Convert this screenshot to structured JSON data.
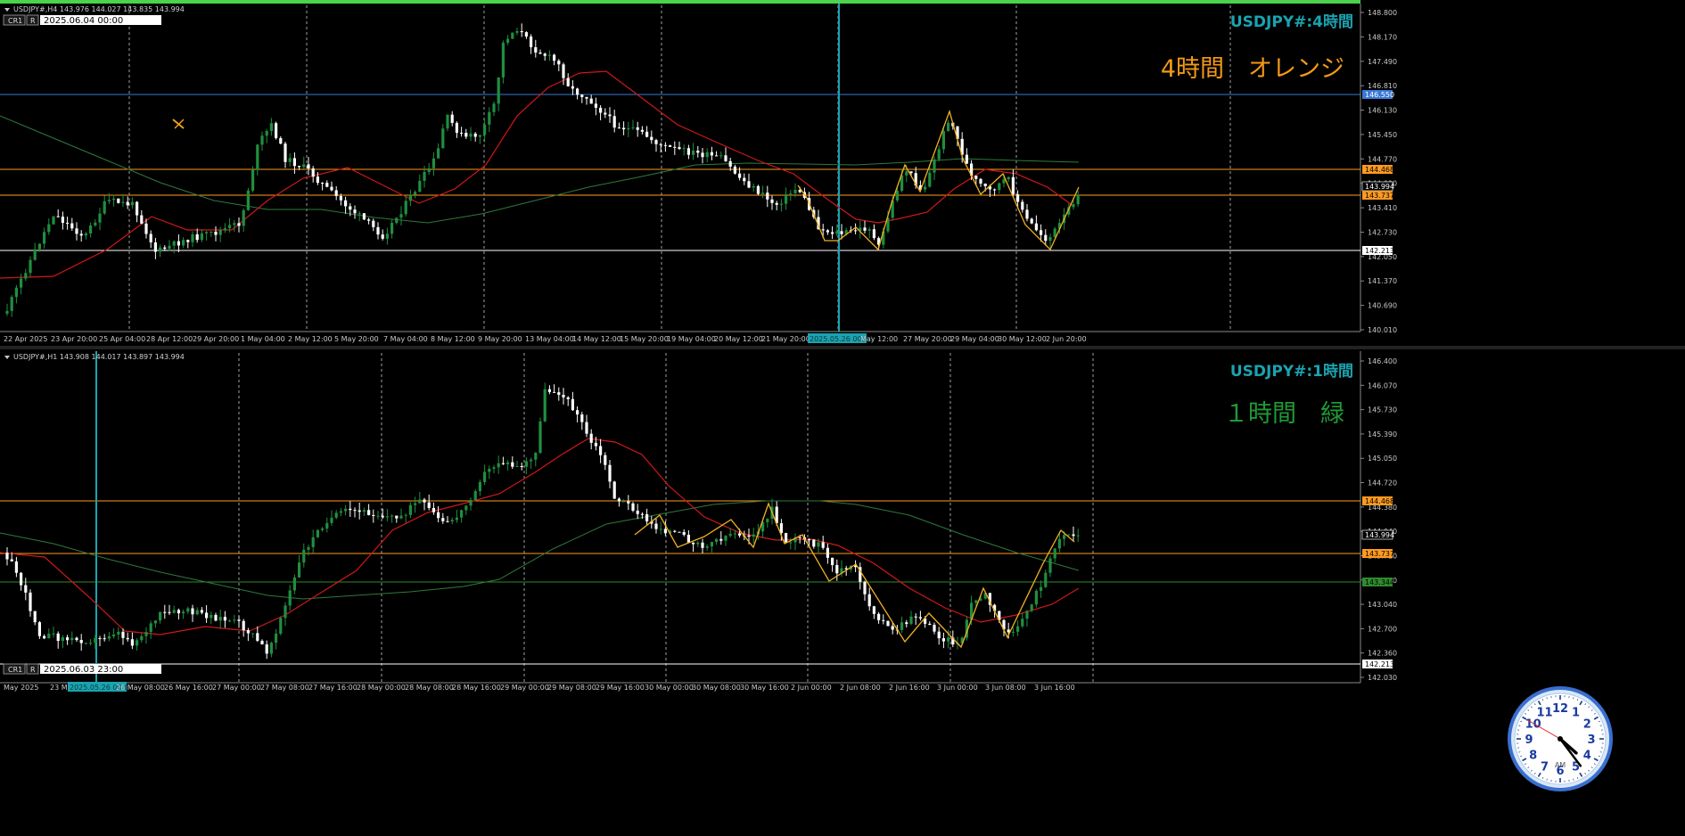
{
  "colors": {
    "background": "#000000",
    "grid": "#c8c8c8",
    "bull": "#1f8f3f",
    "bear": "#ffffff",
    "ma_fast": "#d01818",
    "ma_slow": "#2e7a3c",
    "zigzag": "#f0b020",
    "hline_orange": "#ff9a1f",
    "hline_blue": "#3a78d8",
    "hline_white": "#ffffff",
    "hline_green": "#2e8a2e",
    "vline": "#1aa3b0",
    "title_teal": "#1aa3b0",
    "label_orange": "#f39a14",
    "label_green": "#1f9a36",
    "axis_text": "#c8c8c8",
    "top_border": "#4cd24c"
  },
  "top_chart": {
    "info": "USDJPY#,H4  143.976 144.027 143.835 143.994",
    "cr_label": "CR1",
    "r_label": "R",
    "date_box": "2025.06.04 00:00",
    "title": "USDJPY#:4時間",
    "subtitle": "4時間　オレンジ",
    "price_labels": [
      "148.800",
      "148.170",
      "147.490",
      "146.810",
      "146.130",
      "145.450",
      "144.770",
      "144.090",
      "143.410",
      "142.730",
      "142.050",
      "141.370",
      "140.690",
      "140.010"
    ],
    "marked_prices": [
      {
        "text": "146.550",
        "kind": "blue"
      },
      {
        "text": "144.468",
        "kind": "orange"
      },
      {
        "text": "143.994",
        "kind": "current"
      },
      {
        "text": "143.737",
        "kind": "orange"
      },
      {
        "text": "142.213",
        "kind": "white"
      }
    ],
    "time_labels": [
      "22 Apr 2025",
      "23 Apr 20:00",
      "25 Apr 04:00",
      "28 Apr 12:00",
      "29 Apr 20:00",
      "1 May 04:00",
      "2 May 12:00",
      "5 May 20:00",
      "7 May 04:00",
      "8 May 12:00",
      "9 May 20:00",
      "13 May 04:00",
      "14 May 12:00",
      "15 May 20:00",
      "19 May 04:00",
      "20 May 12:00",
      "21 May 20:00",
      "2025.05.26 00:00",
      "May 12:00",
      "27 May 20:00",
      "29 May 04:00",
      "30 May 12:00",
      "2 Jun 20:00"
    ]
  },
  "bottom_chart": {
    "info": "USDJPY#,H1  143.908 144.017 143.897 143.994",
    "cr_label": "CR1",
    "r_label": "R",
    "date_box": "2025.06.03 23:00",
    "title": "USDJPY#:1時間",
    "subtitle": "１時間　緑",
    "price_labels": [
      "146.400",
      "146.070",
      "145.730",
      "145.390",
      "145.050",
      "144.720",
      "144.380",
      "144.040",
      "143.710",
      "143.370",
      "143.040",
      "142.700",
      "142.360",
      "142.030"
    ],
    "marked_prices": [
      {
        "text": "144.468",
        "kind": "orange"
      },
      {
        "text": "143.994",
        "kind": "current"
      },
      {
        "text": "143.737",
        "kind": "orange"
      },
      {
        "text": "143.344",
        "kind": "green"
      },
      {
        "text": "142.213",
        "kind": "white"
      }
    ],
    "time_labels": [
      "May 2025",
      "23 M",
      "2025.05.26 00:00",
      "26 May 08:00",
      "26 May 16:00",
      "27 May 00:00",
      "27 May 08:00",
      "27 May 16:00",
      "28 May 00:00",
      "28 May 08:00",
      "28 May 16:00",
      "29 May 00:00",
      "29 May 08:00",
      "29 May 16:00",
      "30 May 00:00",
      "30 May 08:00",
      "30 May 16:00",
      "2 Jun 00:00",
      "2 Jun 08:00",
      "2 Jun 16:00",
      "3 Jun 00:00",
      "3 Jun 08:00",
      "3 Jun 16:00"
    ]
  },
  "clock": {
    "numbers": [
      "12",
      "1",
      "2",
      "3",
      "4",
      "5",
      "6",
      "7",
      "8",
      "9",
      "10",
      "11"
    ],
    "ampm": "AM",
    "hour": 4,
    "minute": 23,
    "second": 50
  }
}
